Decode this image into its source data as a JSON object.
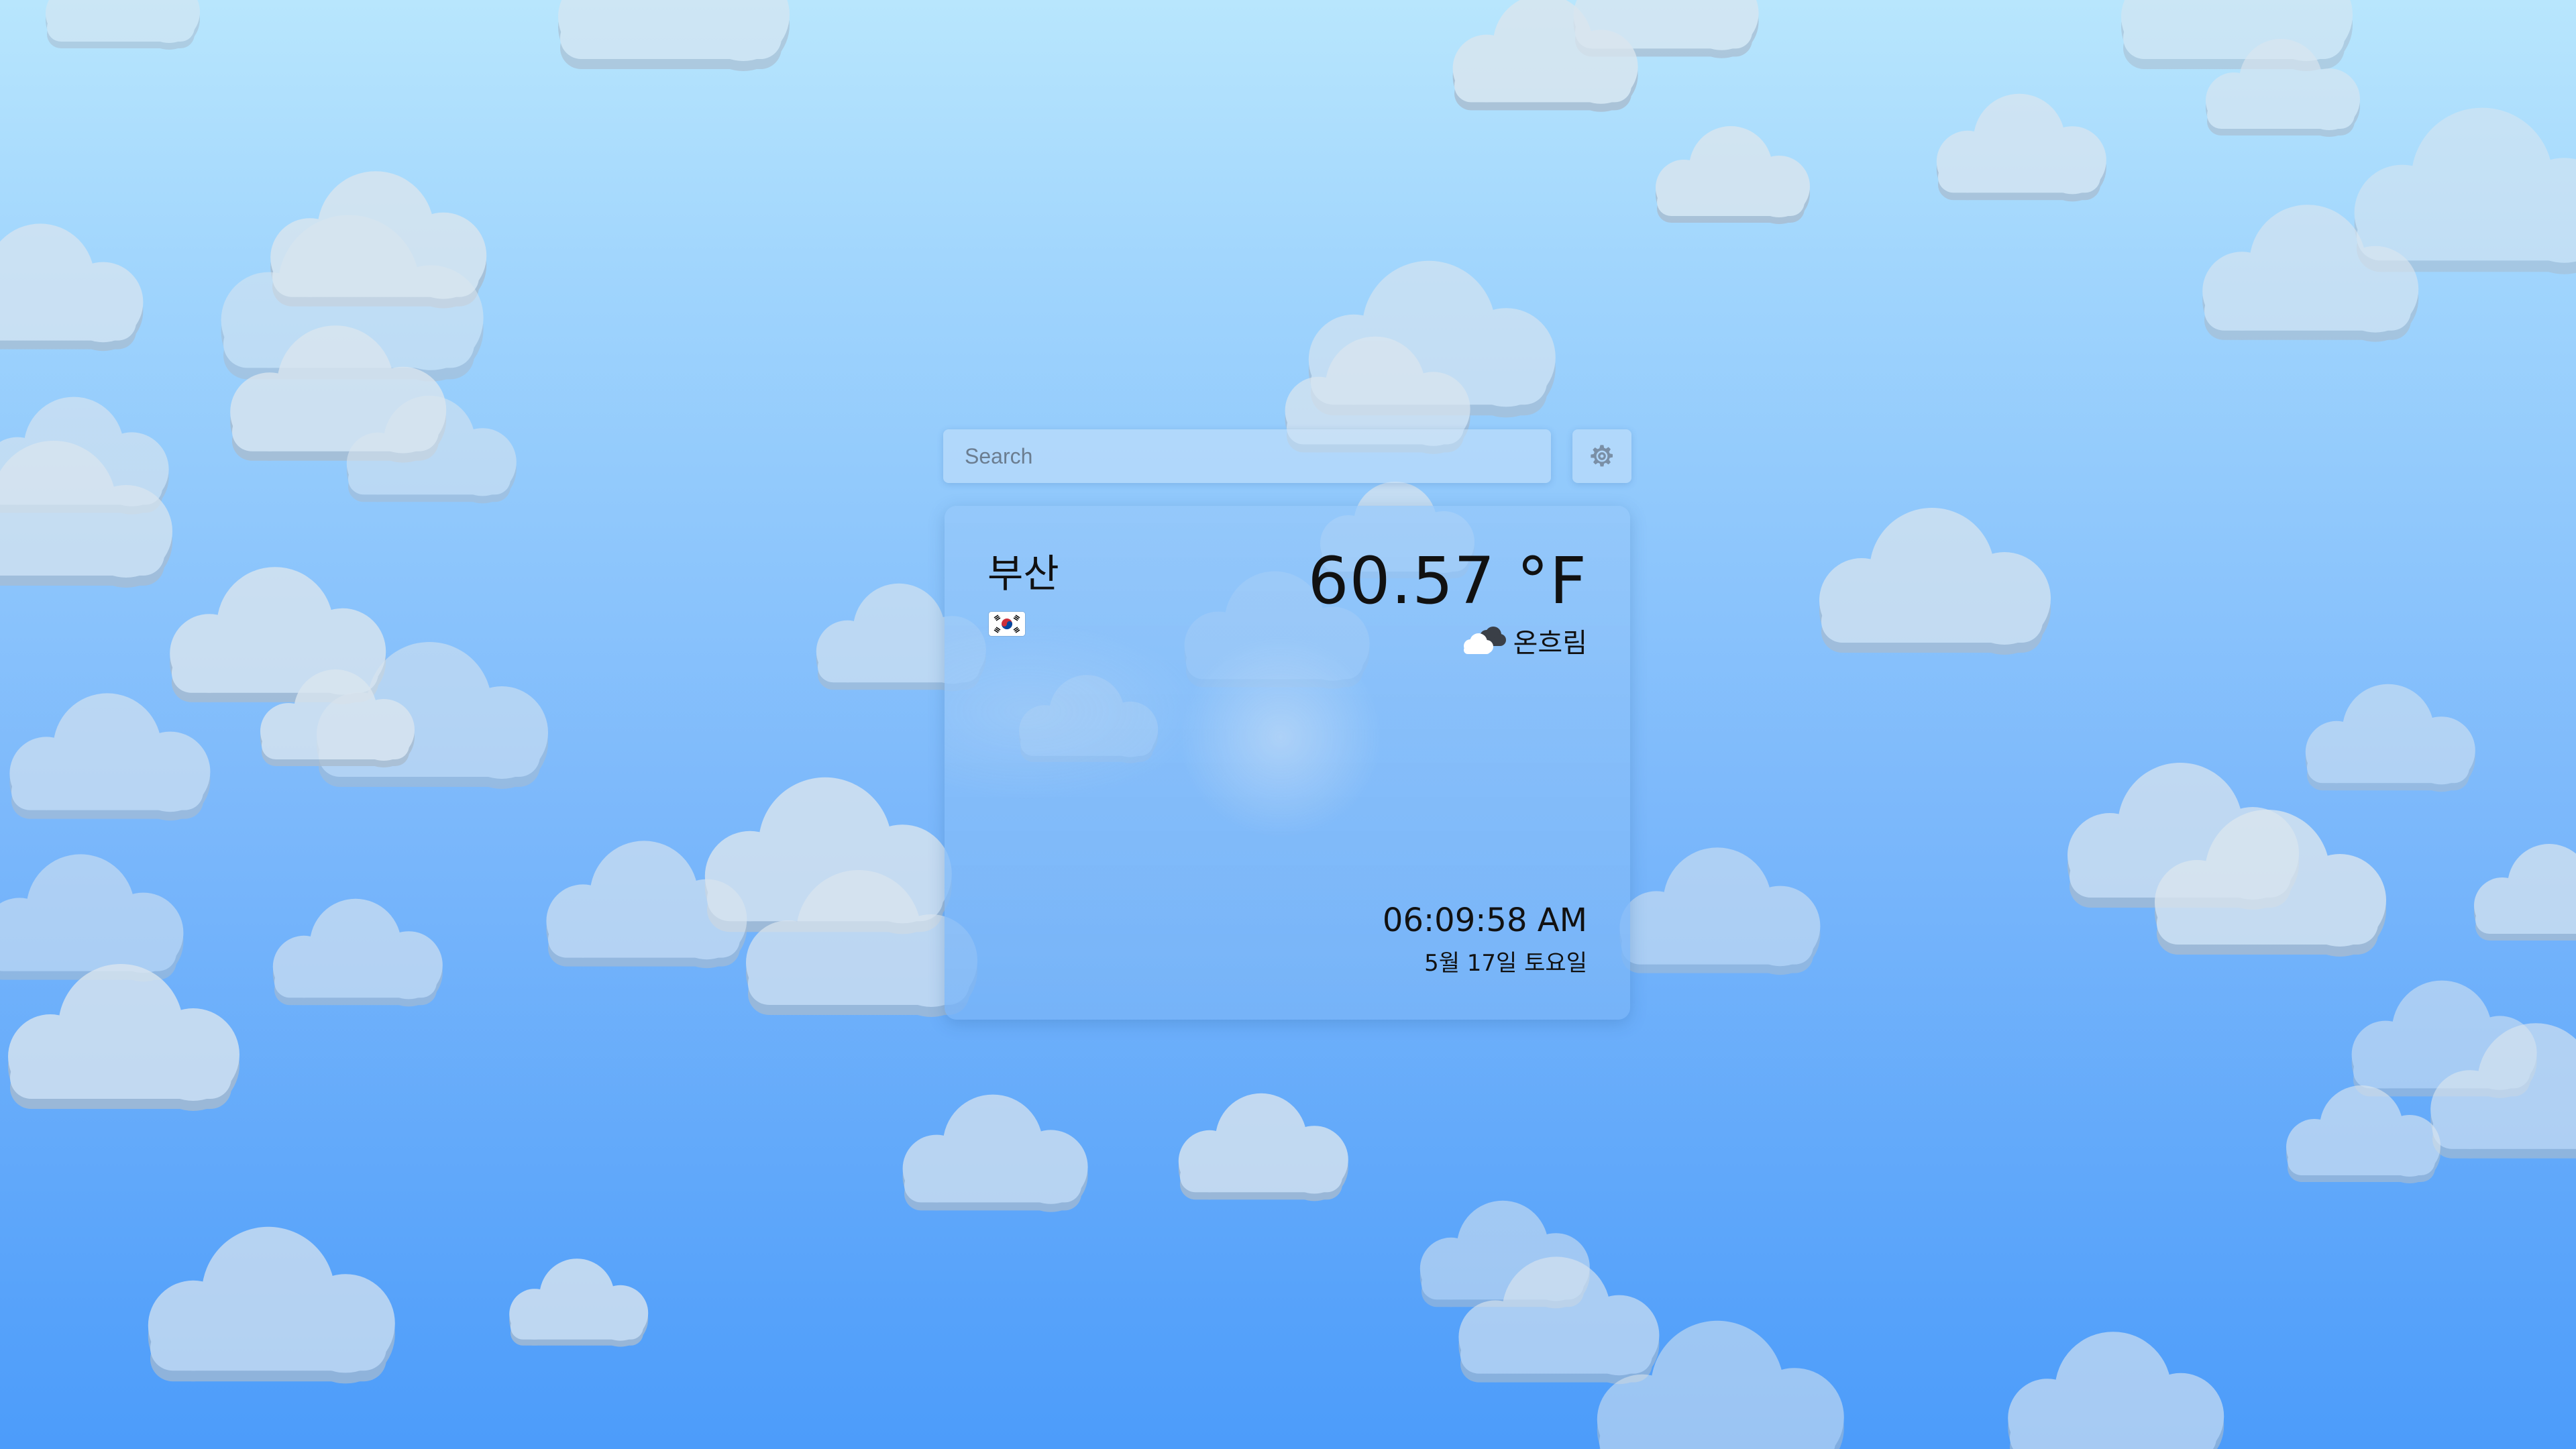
{
  "search": {
    "placeholder": "Search",
    "value": ""
  },
  "settings": {
    "icon": "gear-icon"
  },
  "weather": {
    "city": "부산",
    "country_flag": "south-korea-flag",
    "temperature": "60.57 °F",
    "condition": "온흐림",
    "condition_icon": "cloudy-icon",
    "time": "06:09:58 AM",
    "date": "5월 17일 토요일"
  },
  "colors": {
    "sky_top": "#b8e6fd",
    "sky_bottom": "#4c9cfa",
    "text": "#111111"
  }
}
